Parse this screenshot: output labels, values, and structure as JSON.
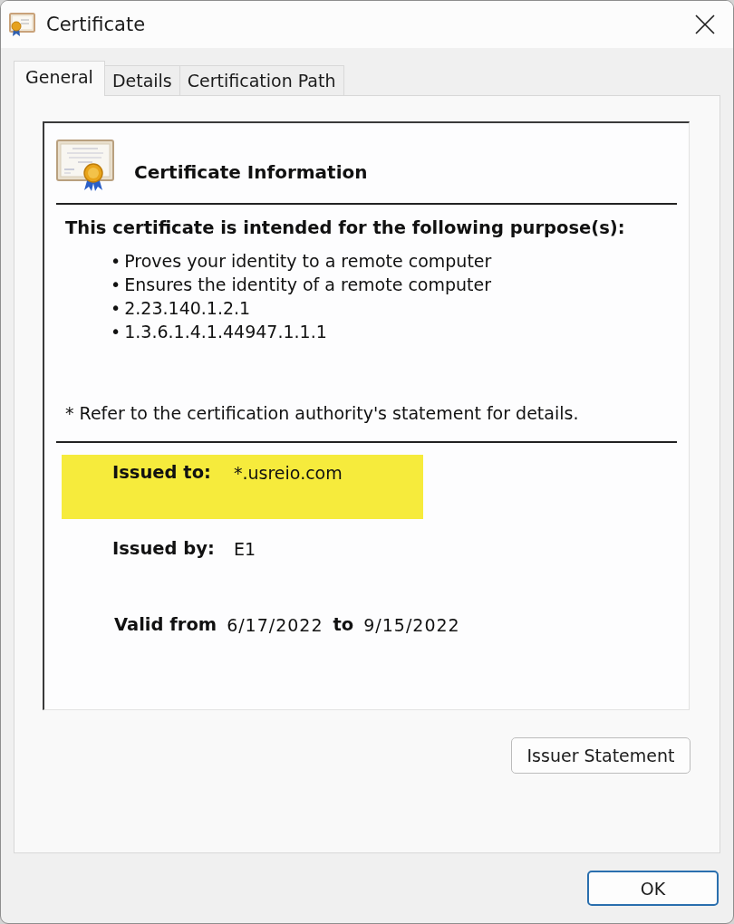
{
  "window": {
    "title": "Certificate"
  },
  "tabs": [
    {
      "label": "General",
      "selected": true
    },
    {
      "label": "Details",
      "selected": false
    },
    {
      "label": "Certification Path",
      "selected": false
    }
  ],
  "info": {
    "heading": "Certificate Information",
    "purposes_heading": "This certificate is intended for the following purpose(s):",
    "purposes": [
      {
        "bullet": "•",
        "text": "Proves your identity to a remote computer"
      },
      {
        "bullet": "•",
        "text": "Ensures the identity of a remote computer"
      },
      {
        "bullet": "•",
        "text": "2.23.140.1.2.1"
      },
      {
        "bullet": "•",
        "text": "1.3.6.1.4.1.44947.1.1.1"
      }
    ],
    "note": "* Refer to the certification authority's statement for details."
  },
  "fields": [
    {
      "label": "Issued to:",
      "value": "*.usreio.com",
      "highlighted": true
    },
    {
      "label": "Issued by:",
      "value": "E1",
      "highlighted": false
    }
  ],
  "validity": {
    "label": "Valid from",
    "from": "6/17/2022",
    "separator": "to",
    "to": "9/15/2022"
  },
  "buttons": {
    "issuer_statement": "Issuer Statement",
    "ok": "OK"
  }
}
